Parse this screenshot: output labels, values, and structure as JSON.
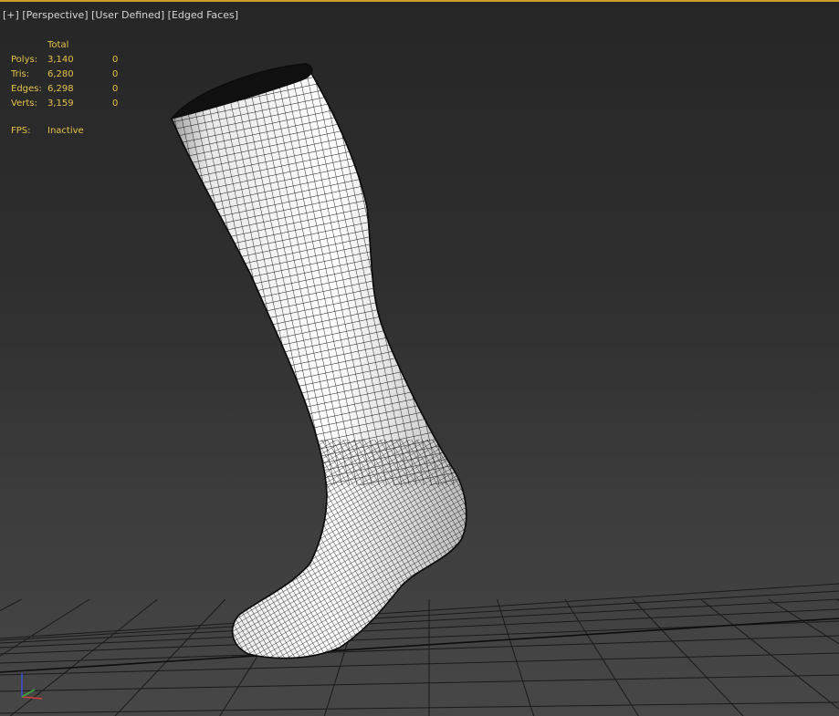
{
  "viewport": {
    "labels": [
      "[+]",
      "[Perspective]",
      "[User Defined]",
      "[Edged Faces]"
    ],
    "background_top": "#262626",
    "background_bottom": "#474747",
    "accent_border": "#c9a227"
  },
  "stats": {
    "header": "Total",
    "rows": [
      {
        "label": "Polys:",
        "total": "3,140",
        "selected": "0"
      },
      {
        "label": "Tris:",
        "total": "6,280",
        "selected": "0"
      },
      {
        "label": "Edges:",
        "total": "6,298",
        "selected": "0"
      },
      {
        "label": "Verts:",
        "total": "3,159",
        "selected": "0"
      }
    ],
    "fps_label": "FPS:",
    "fps_value": "Inactive",
    "text_color": "#e6c34b"
  },
  "model": {
    "name": "sock-mesh",
    "color": "#f2f2f2",
    "wire_color": "#111111"
  },
  "axis_gizmo": {
    "axes": [
      "z",
      "x",
      "y"
    ],
    "colors": {
      "x": "#d23c3c",
      "y": "#3cb43c",
      "z": "#3c50d2"
    }
  },
  "grid": {
    "color": "#1a1a1a"
  }
}
